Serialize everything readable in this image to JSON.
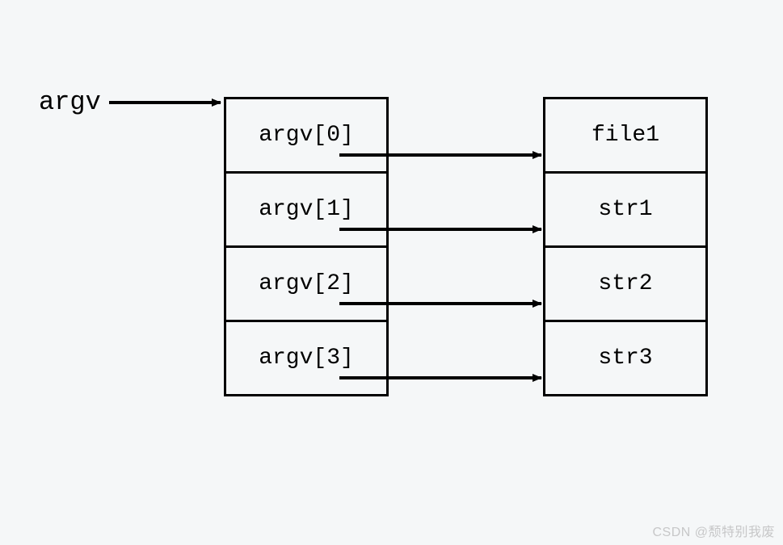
{
  "pointer_label": "argv",
  "left_column": [
    "argv[0]",
    "argv[1]",
    "argv[2]",
    "argv[3]"
  ],
  "right_column": [
    "file1",
    "str1",
    "str2",
    "str3"
  ],
  "watermark": "CSDN @颓特别我废"
}
